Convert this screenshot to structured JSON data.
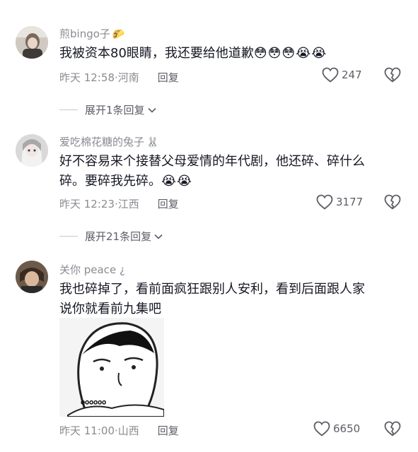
{
  "comments": [
    {
      "username": "煎bingo子",
      "username_emoji": "🌮",
      "text": "我被资本80眼睛，我还要给他道歉",
      "emojis": "😳😳😳😭😭",
      "time": "昨天 12:58",
      "location": "河南",
      "reply_label": "回复",
      "likes": "247",
      "expand_label": "展开1条回复"
    },
    {
      "username": "爱吃棉花糖的兔子",
      "username_emoji": "🐰",
      "text_line1": "好不容易来个接替父母爱情的年代剧，他还碎、碎什么",
      "text_line2": "碎。要碎我先碎。",
      "emojis": "😭😭",
      "time": "昨天 12:23",
      "location": "江西",
      "reply_label": "回复",
      "likes": "3177",
      "expand_label": "展开21条回复"
    },
    {
      "username": "关你 peace ¿",
      "text_line1": "我也碎掉了，看前面疯狂跟别人安利，看到后面跟人家",
      "text_line2": "说你就看前九集吧",
      "sticker_caption": "。。。。。。",
      "time": "昨天 11:00",
      "location": "山西",
      "reply_label": "回复",
      "likes": "6650"
    }
  ]
}
